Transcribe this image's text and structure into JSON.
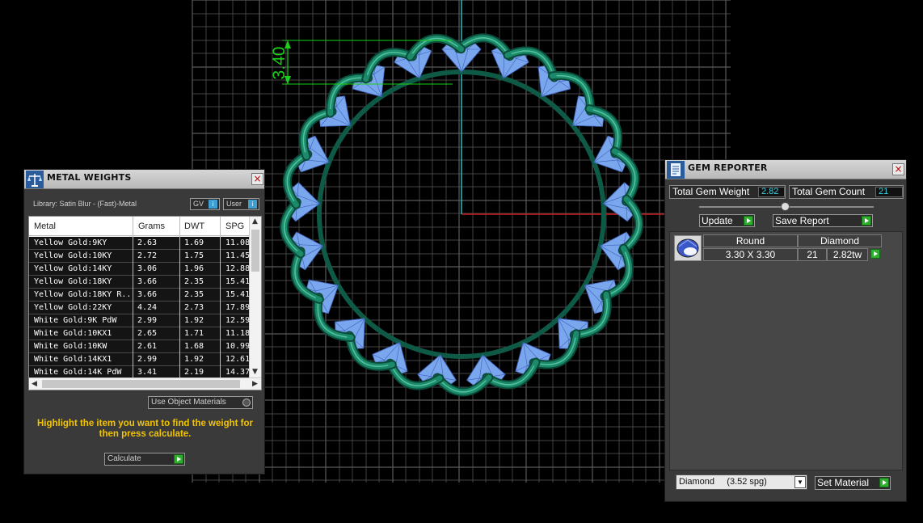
{
  "viewport": {
    "dimension_label": "3.40"
  },
  "metal_weights": {
    "title": "METAL WEIGHTS",
    "library_label": "Library: Satin Blur - (Fast)-Metal",
    "gv_label": "GV",
    "user_label": "User",
    "columns": [
      "Metal",
      "Grams",
      "DWT",
      "SPG"
    ],
    "rows": [
      {
        "metal": "Yellow Gold:9KY",
        "grams": "2.63",
        "dwt": "1.69",
        "spg": "11.08"
      },
      {
        "metal": "Yellow Gold:10KY",
        "grams": "2.72",
        "dwt": "1.75",
        "spg": "11.45"
      },
      {
        "metal": "Yellow Gold:14KY",
        "grams": "3.06",
        "dwt": "1.96",
        "spg": "12.88"
      },
      {
        "metal": "Yellow Gold:18KY",
        "grams": "3.66",
        "dwt": "2.35",
        "spg": "15.41"
      },
      {
        "metal": "Yellow Gold:18KY R...",
        "grams": "3.66",
        "dwt": "2.35",
        "spg": "15.41"
      },
      {
        "metal": "Yellow Gold:22KY",
        "grams": "4.24",
        "dwt": "2.73",
        "spg": "17.89"
      },
      {
        "metal": "White Gold:9K PdW",
        "grams": "2.99",
        "dwt": "1.92",
        "spg": "12.59"
      },
      {
        "metal": "White Gold:10KX1",
        "grams": "2.65",
        "dwt": "1.71",
        "spg": "11.18"
      },
      {
        "metal": "White Gold:10KW",
        "grams": "2.61",
        "dwt": "1.68",
        "spg": "10.99"
      },
      {
        "metal": "White Gold:14KX1",
        "grams": "2.99",
        "dwt": "1.92",
        "spg": "12.61"
      },
      {
        "metal": "White Gold:14K PdW",
        "grams": "3.41",
        "dwt": "2.19",
        "spg": "14.37"
      }
    ],
    "use_object_materials": "Use Object Materials",
    "hint": "Highlight the item you want to find the weight for then press calculate.",
    "calculate_label": "Calculate"
  },
  "gem_reporter": {
    "title": "GEM REPORTER",
    "total_weight_label": "Total Gem Weight",
    "total_weight_value": "2.82",
    "total_count_label": "Total Gem Count",
    "total_count_value": "21",
    "update_label": "Update",
    "save_report_label": "Save Report",
    "gem": {
      "shape": "Round",
      "material": "Diamond",
      "size": "3.30 X 3.30",
      "count": "21",
      "weight": "2.82tw"
    },
    "material_select": "Diamond     (3.52 spg)",
    "set_material_label": "Set Material"
  },
  "colors": {
    "grid": "#5a5a5a",
    "axis_y": "#2bb8c8",
    "axis_x": "#c81e1e",
    "prong": "#1a8a6a",
    "gem": "#7aa6ee",
    "dimension": "#19d019",
    "hint": "#f2c400"
  }
}
